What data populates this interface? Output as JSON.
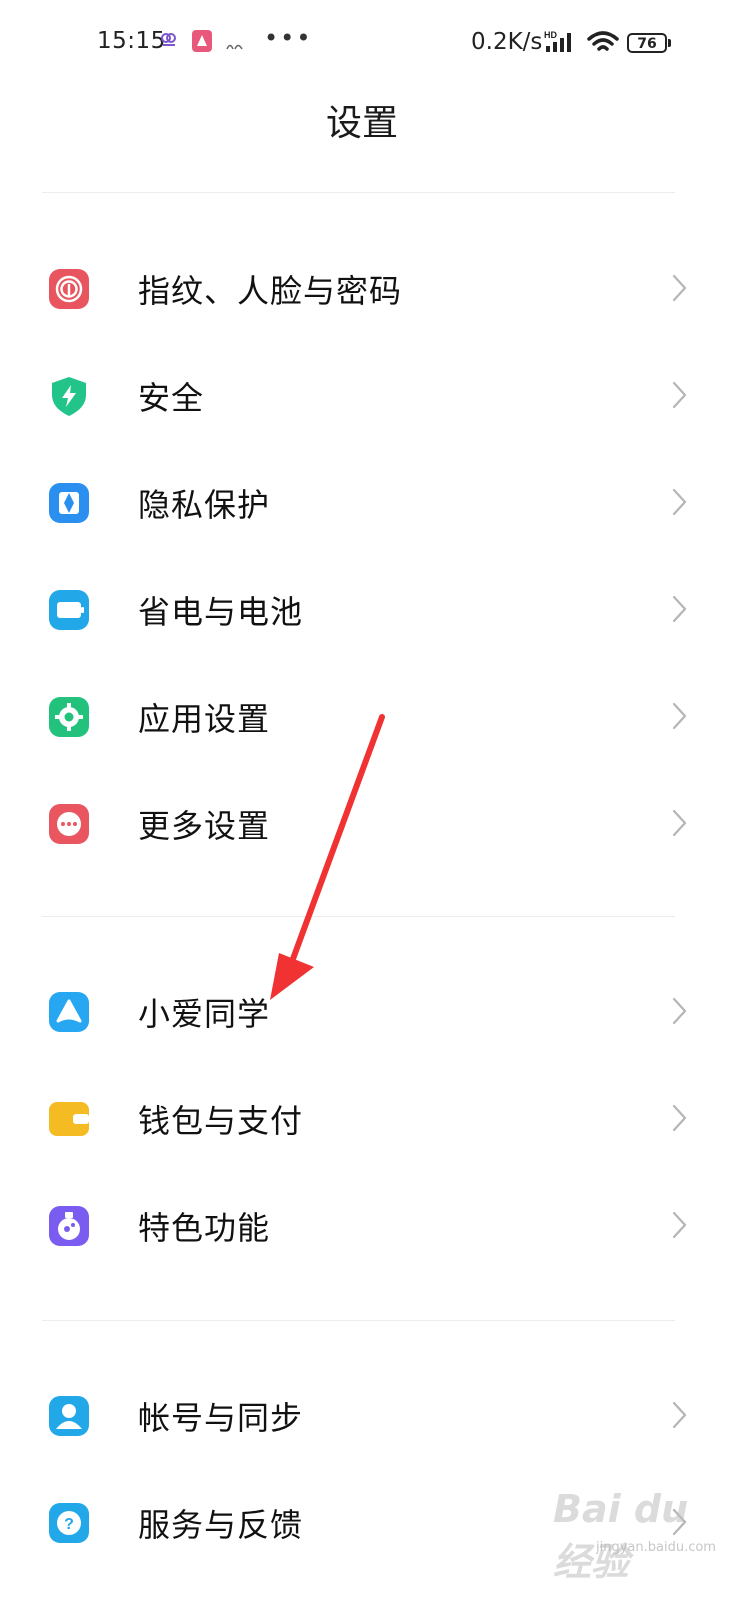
{
  "status_bar": {
    "time": "15:15",
    "network_speed": "0.2K/s",
    "signal_badge": "HD",
    "battery_level": "76",
    "more_icon": "•••",
    "notif_icons": [
      "cloud-icon",
      "app-icon",
      "app-logo-icon"
    ]
  },
  "header": {
    "title": "设置"
  },
  "settings": {
    "group1": [
      {
        "label": "指纹、人脸与密码",
        "icon": "fingerprint-icon",
        "color": "#e9555f"
      },
      {
        "label": "安全",
        "icon": "shield-icon",
        "color": "#22c48a"
      },
      {
        "label": "隐私保护",
        "icon": "privacy-icon",
        "color": "#2b8ff0"
      },
      {
        "label": "省电与电池",
        "icon": "battery-icon",
        "color": "#22a8e8"
      },
      {
        "label": "应用设置",
        "icon": "gear-icon",
        "color": "#22c27d"
      },
      {
        "label": "更多设置",
        "icon": "more-icon",
        "color": "#ea5660"
      }
    ],
    "group2": [
      {
        "label": "小爱同学",
        "icon": "xiaoai-icon",
        "color": "#27a7f2"
      },
      {
        "label": "钱包与支付",
        "icon": "wallet-icon",
        "color": "#f5bb22"
      },
      {
        "label": "特色功能",
        "icon": "feature-icon",
        "color": "#7a5cf0"
      }
    ],
    "group3": [
      {
        "label": "帐号与同步",
        "icon": "account-icon",
        "color": "#22a8e8"
      },
      {
        "label": "服务与反馈",
        "icon": "help-icon",
        "color": "#22a8e8"
      }
    ]
  },
  "watermark": {
    "text": "Bai du 经验",
    "sub": "jingyan.baidu.com"
  }
}
